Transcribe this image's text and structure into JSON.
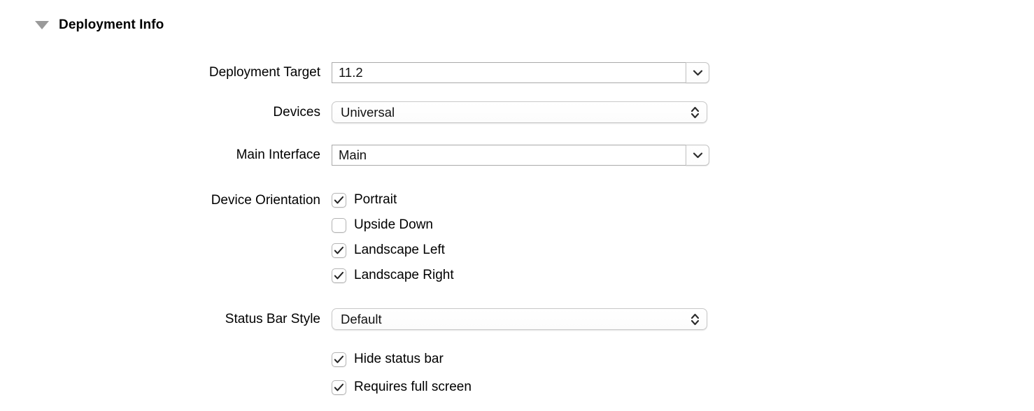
{
  "section": {
    "title": "Deployment Info",
    "disclosure_icon": "triangle-down-icon",
    "expanded": true
  },
  "fields": {
    "deployment_target": {
      "label": "Deployment Target",
      "value": "11.2",
      "control": "combo-box",
      "icon": "chevron-down-icon"
    },
    "devices": {
      "label": "Devices",
      "value": "Universal",
      "control": "pop-up-button",
      "icon": "chevron-up-down-icon"
    },
    "main_interface": {
      "label": "Main Interface",
      "value": "Main",
      "control": "combo-box",
      "icon": "chevron-down-icon"
    },
    "status_bar_style": {
      "label": "Status Bar Style",
      "value": "Default",
      "control": "pop-up-button",
      "icon": "chevron-up-down-icon"
    }
  },
  "device_orientation": {
    "label": "Device Orientation",
    "options": [
      {
        "label": "Portrait",
        "checked": true
      },
      {
        "label": "Upside Down",
        "checked": false
      },
      {
        "label": "Landscape Left",
        "checked": true
      },
      {
        "label": "Landscape Right",
        "checked": true
      }
    ]
  },
  "status_bar_options": [
    {
      "label": "Hide status bar",
      "checked": true
    },
    {
      "label": "Requires full screen",
      "checked": true
    }
  ],
  "colors": {
    "background": "#ffffff",
    "text": "#000000",
    "field_border": "#a9a9a9",
    "control_border": "#c8c8c8",
    "disclosure": "#9a9a9a",
    "checkmark": "#222222"
  }
}
